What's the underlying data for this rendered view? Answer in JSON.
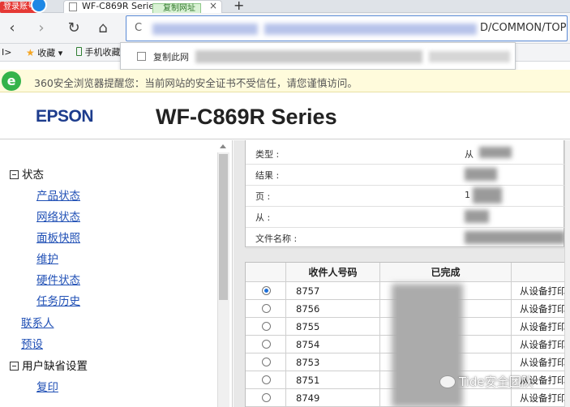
{
  "browser": {
    "login_badge": "登录账号",
    "tab_title": "WF-C869R Series",
    "tab_tooltip": "复制网址",
    "tab_close": "×",
    "tab_new": "+",
    "nav": {
      "back": "‹",
      "forward": "›",
      "reload": "↻",
      "home": "⌂"
    },
    "address_prefix": "C",
    "address_suffix": "D/COMMON/TOP",
    "bookmarks": {
      "sidebar_toggle": "I>",
      "favorites": "收藏",
      "mobile_favorites": "手机收藏"
    },
    "popup": {
      "label": "复制此网"
    },
    "warning": "360安全浏览器提醒您：当前网站的安全证书不受信任，请您谨慎访问。"
  },
  "epson": {
    "logo": "EPSON",
    "model": "WF-C869R Series"
  },
  "sidebar": {
    "groups": [
      {
        "label": "状态",
        "items": [
          "产品状态",
          "网络状态",
          "面板快照",
          "维护",
          "硬件状态",
          "任务历史"
        ]
      }
    ],
    "contacts": "联系人",
    "presets": "预设",
    "user_defaults": {
      "label": "用户缺省设置",
      "items": [
        "复印"
      ]
    }
  },
  "details": {
    "rows": [
      {
        "label": "类型 :",
        "value": "从"
      },
      {
        "label": "结果 :",
        "value": ""
      },
      {
        "label": "页 :",
        "value": "1"
      },
      {
        "label": "从 :",
        "value": ""
      },
      {
        "label": "文件名称 :",
        "value": ""
      }
    ]
  },
  "jobs": {
    "headers": [
      "",
      "收件人号码",
      "已完成",
      ""
    ],
    "rows": [
      {
        "number": "8757",
        "source": "从设备打印",
        "selected": true
      },
      {
        "number": "8756",
        "source": "从设备打印",
        "selected": false
      },
      {
        "number": "8755",
        "source": "从设备打印",
        "selected": false
      },
      {
        "number": "8754",
        "source": "从设备打印",
        "selected": false
      },
      {
        "number": "8753",
        "source": "从设备打印",
        "selected": false
      },
      {
        "number": "8751",
        "source": "从设备打印",
        "selected": false
      },
      {
        "number": "8749",
        "source": "从设备打印",
        "selected": false
      }
    ]
  },
  "watermark": "Tide安全团队",
  "colors": {
    "epson_blue": "#1d3c8d",
    "link_blue": "#1f4fb5",
    "warning_bg": "#fffbdc",
    "radio_selected": "#1e6fd9"
  }
}
